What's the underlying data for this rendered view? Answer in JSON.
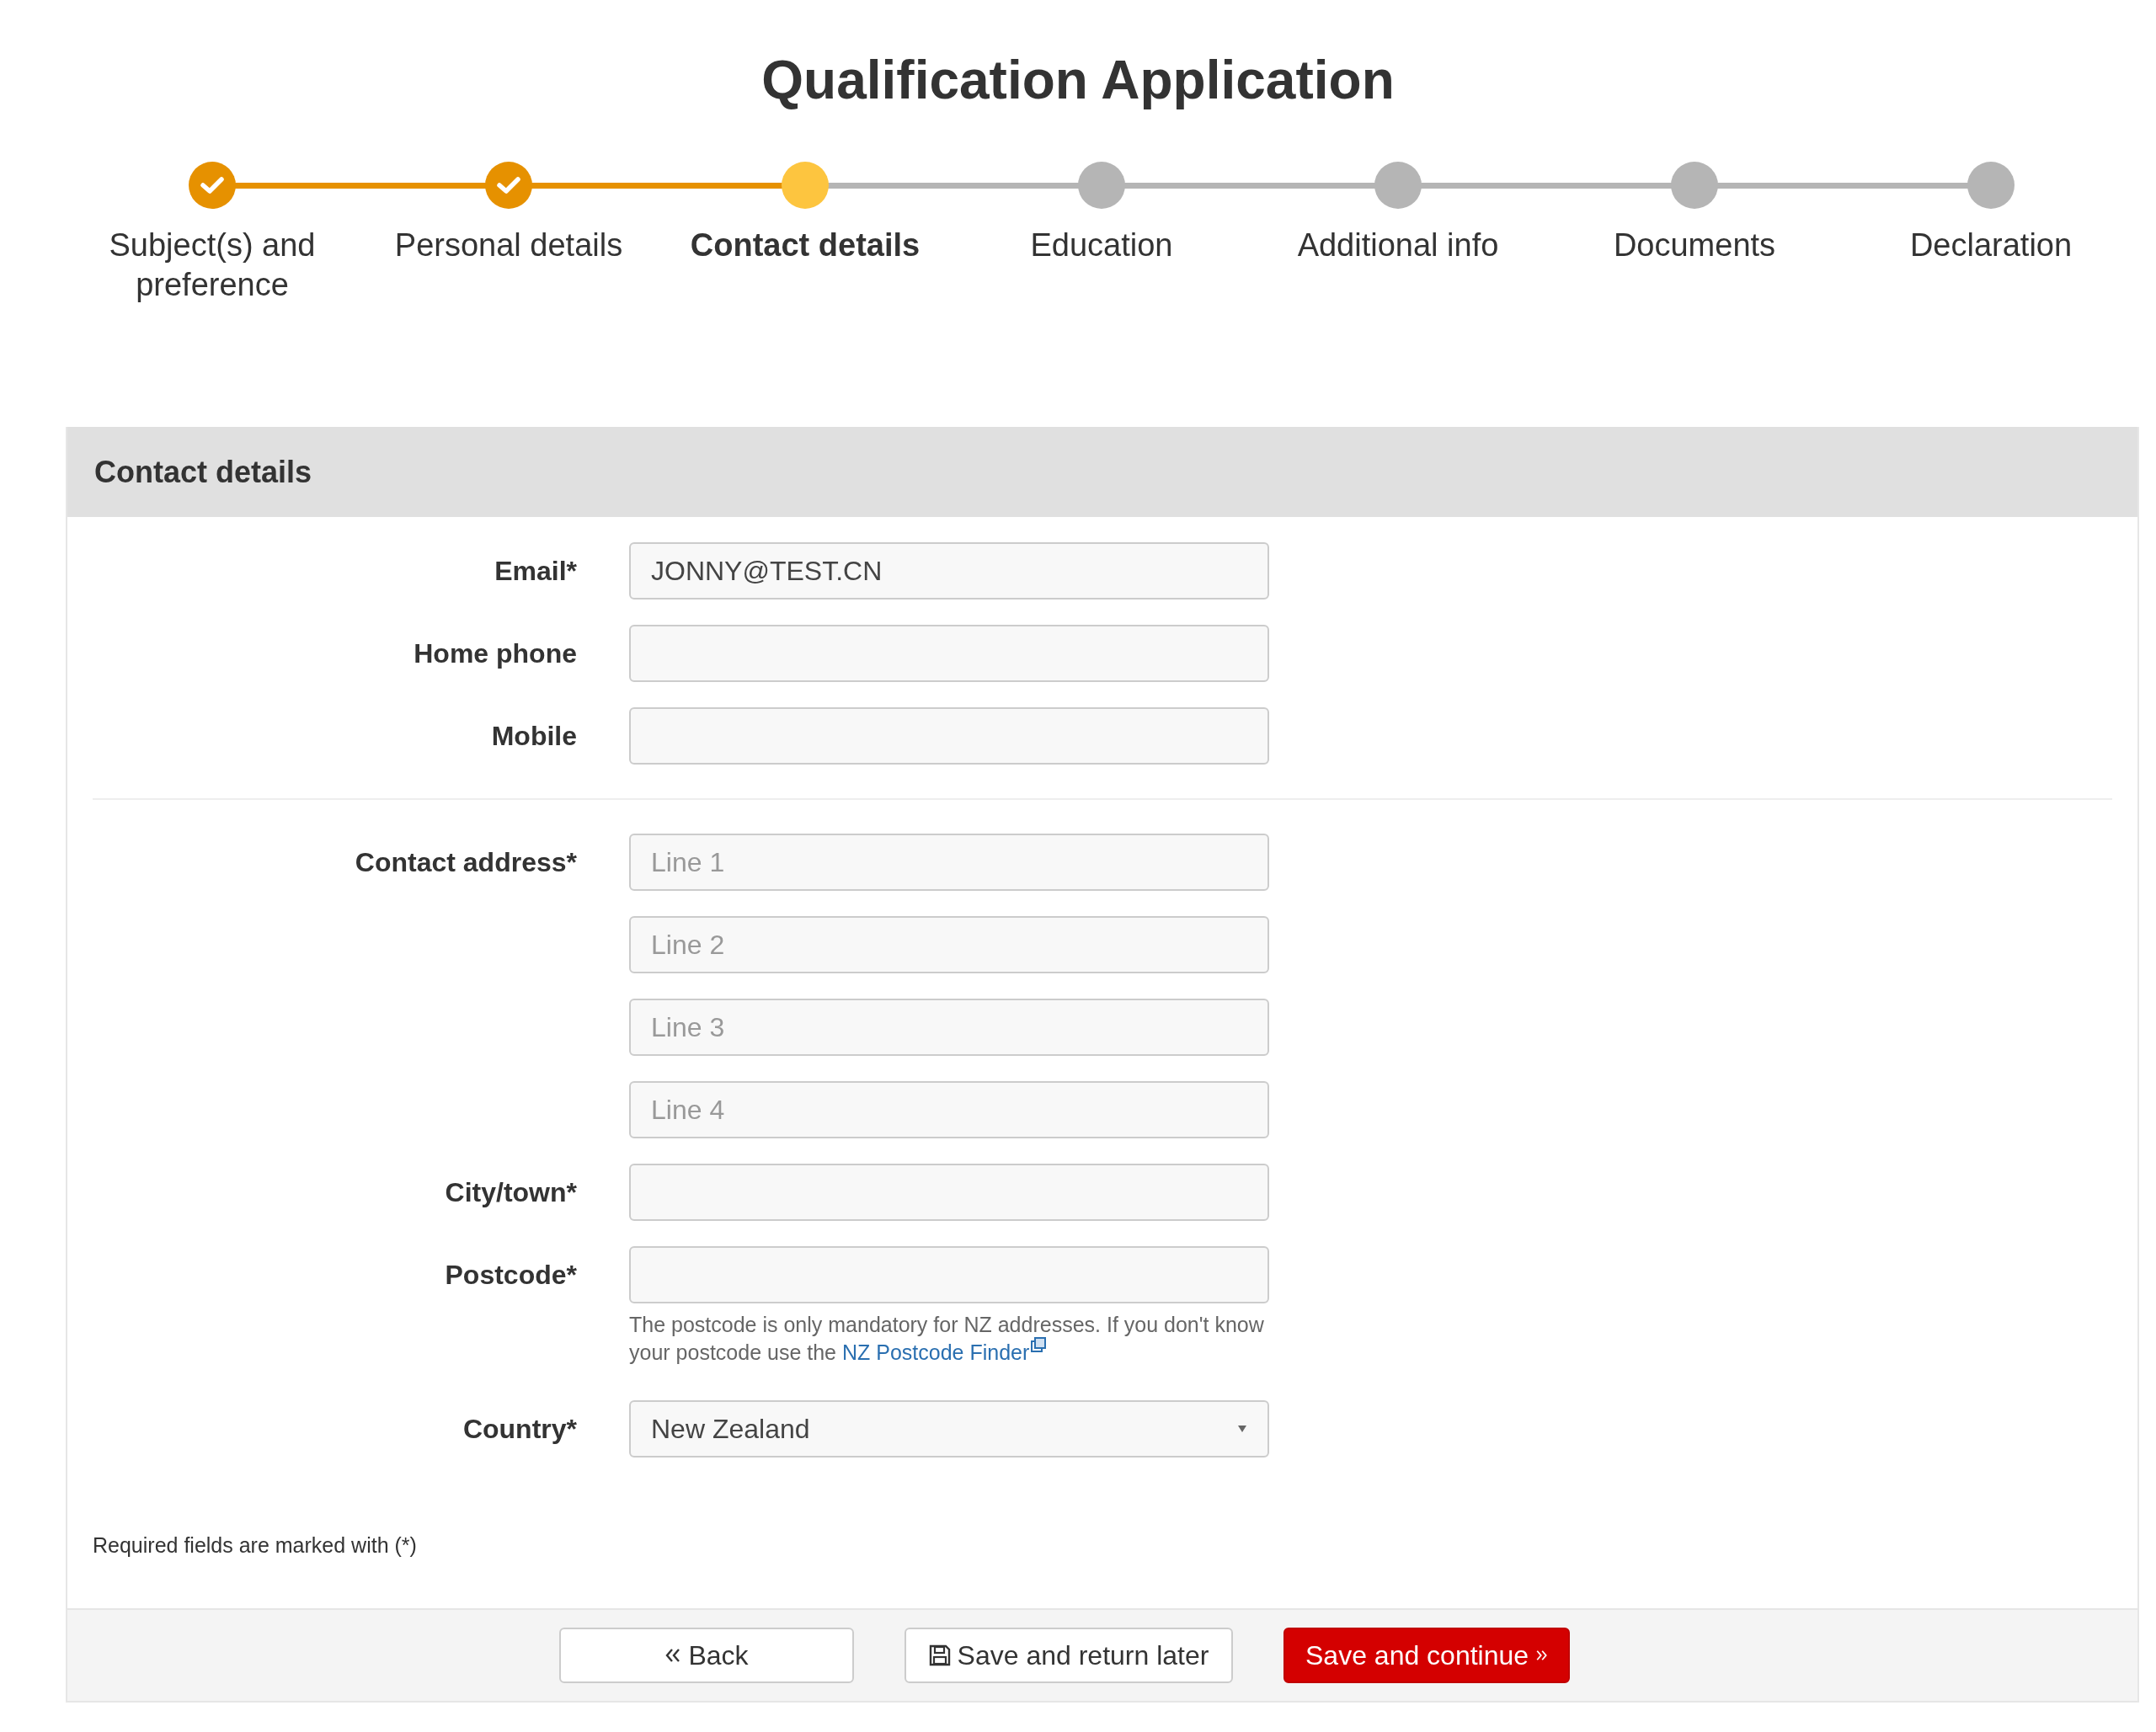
{
  "title": "Qualification Application",
  "steps": [
    {
      "label": "Subject(s) and preference",
      "completed": true,
      "selected": false
    },
    {
      "label": "Personal details",
      "completed": true,
      "selected": false
    },
    {
      "label": "Contact details",
      "completed": false,
      "selected": true
    },
    {
      "label": "Education",
      "completed": false,
      "selected": false
    },
    {
      "label": "Additional info",
      "completed": false,
      "selected": false
    },
    {
      "label": "Documents",
      "completed": false,
      "selected": false
    },
    {
      "label": "Declaration",
      "completed": false,
      "selected": false
    }
  ],
  "panel": {
    "heading": "Contact details",
    "groups": [
      [
        {
          "label": "Email*",
          "kind": "text",
          "value": "JONNY@TEST.CN"
        },
        {
          "label": "Home phone",
          "kind": "text"
        },
        {
          "label": "Mobile",
          "kind": "text"
        }
      ],
      [
        {
          "label": "Contact address*",
          "kind": "text",
          "placeholder": "Line 1"
        },
        {
          "kind": "text",
          "placeholder": "Line 2"
        },
        {
          "kind": "text",
          "placeholder": "Line 3"
        },
        {
          "kind": "text",
          "placeholder": "Line 4"
        },
        {
          "label": "City/town*",
          "kind": "text"
        },
        {
          "label": "Postcode*",
          "kind": "text",
          "help": {
            "text": "The postcode is only mandatory for NZ addresses. If you don't know your postcode use the",
            "link": "NZ Postcode Finder"
          }
        },
        {
          "label": "Country*",
          "kind": "select",
          "value": "New Zealand"
        }
      ]
    ],
    "required_note": "Required fields are marked with (*)"
  },
  "buttons": [
    {
      "label": "Back",
      "kind": "back"
    },
    {
      "label": "Save and return later",
      "kind": "save"
    },
    {
      "label": "Save and continue",
      "kind": "continue"
    }
  ]
}
